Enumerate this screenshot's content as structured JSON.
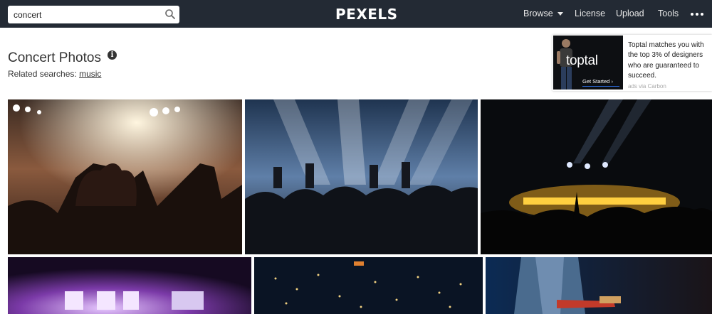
{
  "search": {
    "value": "concert"
  },
  "header": {
    "logo": "PEXELS",
    "nav": [
      {
        "label": "Browse",
        "has_dropdown": true
      },
      {
        "label": "License"
      },
      {
        "label": "Upload"
      },
      {
        "label": "Tools"
      }
    ],
    "more_icon": "ellipsis-icon"
  },
  "page": {
    "title": "Concert Photos",
    "info_glyph": "i",
    "related_label": "Related searches:",
    "related_link": "music"
  },
  "ad": {
    "brand": "toptal",
    "cta": "Get Started",
    "text": "Toptal matches you with the top 3% of designers who are guaranteed to succeed.",
    "via": "ads via Carbon"
  },
  "photos": [
    "crowd-heart-hands-photo",
    "band-on-stage-blue-lights-photo",
    "yellow-stage-lights-crowd-photo",
    "purple-stage-screens-photo",
    "phone-lights-crowd-photo",
    "guitarist-closeup-photo"
  ],
  "colors": {
    "topbar": "#232a34",
    "background": "#ffffff",
    "text": "#333333",
    "link_accent": "#2c6de0"
  }
}
